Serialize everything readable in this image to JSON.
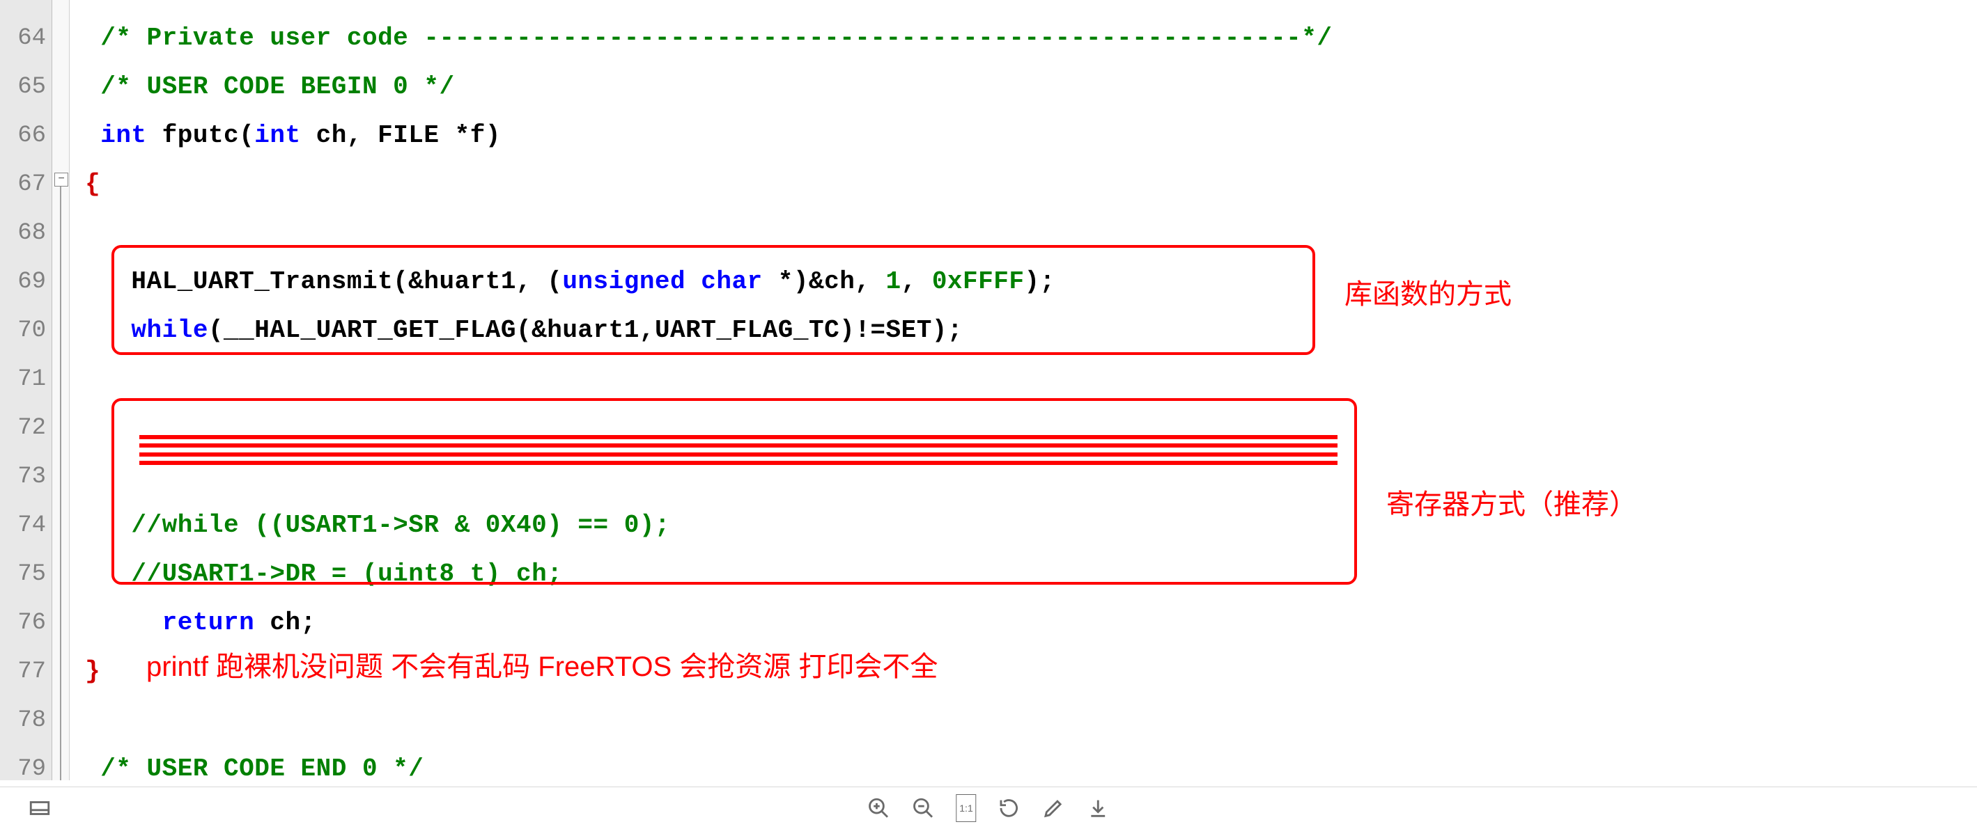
{
  "window_controls": {
    "minimize": "—",
    "maximize": "□",
    "close": "✕"
  },
  "gutter": {
    "start": 64,
    "end": 79
  },
  "code_lines": {
    "l64": "  /* Private user code ---------------------------------------------------------*/",
    "l65": "  /* USER CODE BEGIN 0 */",
    "l66_kw1": "int",
    "l66_fn": " fputc(",
    "l66_kw2": "int",
    "l66_rest": " ch, FILE *f)",
    "l67": " {",
    "l68": "",
    "l69_a": "    HAL_UART_Transmit(&huart1, (",
    "l69_kw": "unsigned char",
    "l69_b": " *)&ch, ",
    "l69_n1": "1",
    "l69_c": ", ",
    "l69_n2": "0xFFFF",
    "l69_d": ");",
    "l70_kw": "    while",
    "l70_rest": "(__HAL_UART_GET_FLAG(&huart1,UART_FLAG_TC)!=SET);",
    "l71": "",
    "l72": "",
    "l73": "    ",
    "l74": "    //while ((USART1->SR & 0X40) == 0);",
    "l75": "    //USART1->DR = (uint8_t) ch;",
    "l76_kw": "      return",
    "l76_rest": " ch;",
    "l77": " }",
    "l78": "",
    "l79": "  /* USER CODE END 0 */"
  },
  "annotations": {
    "lib_way": "库函数的方式",
    "reg_way": "寄存器方式（推荐）",
    "printf_note": "printf 跑裸机没问题 不会有乱码    FreeRTOS  会抢资源 打印会不全"
  },
  "fold": {
    "minus": "−"
  },
  "toolbar": {
    "panel_icon": "▭",
    "oneone": "1:1"
  }
}
